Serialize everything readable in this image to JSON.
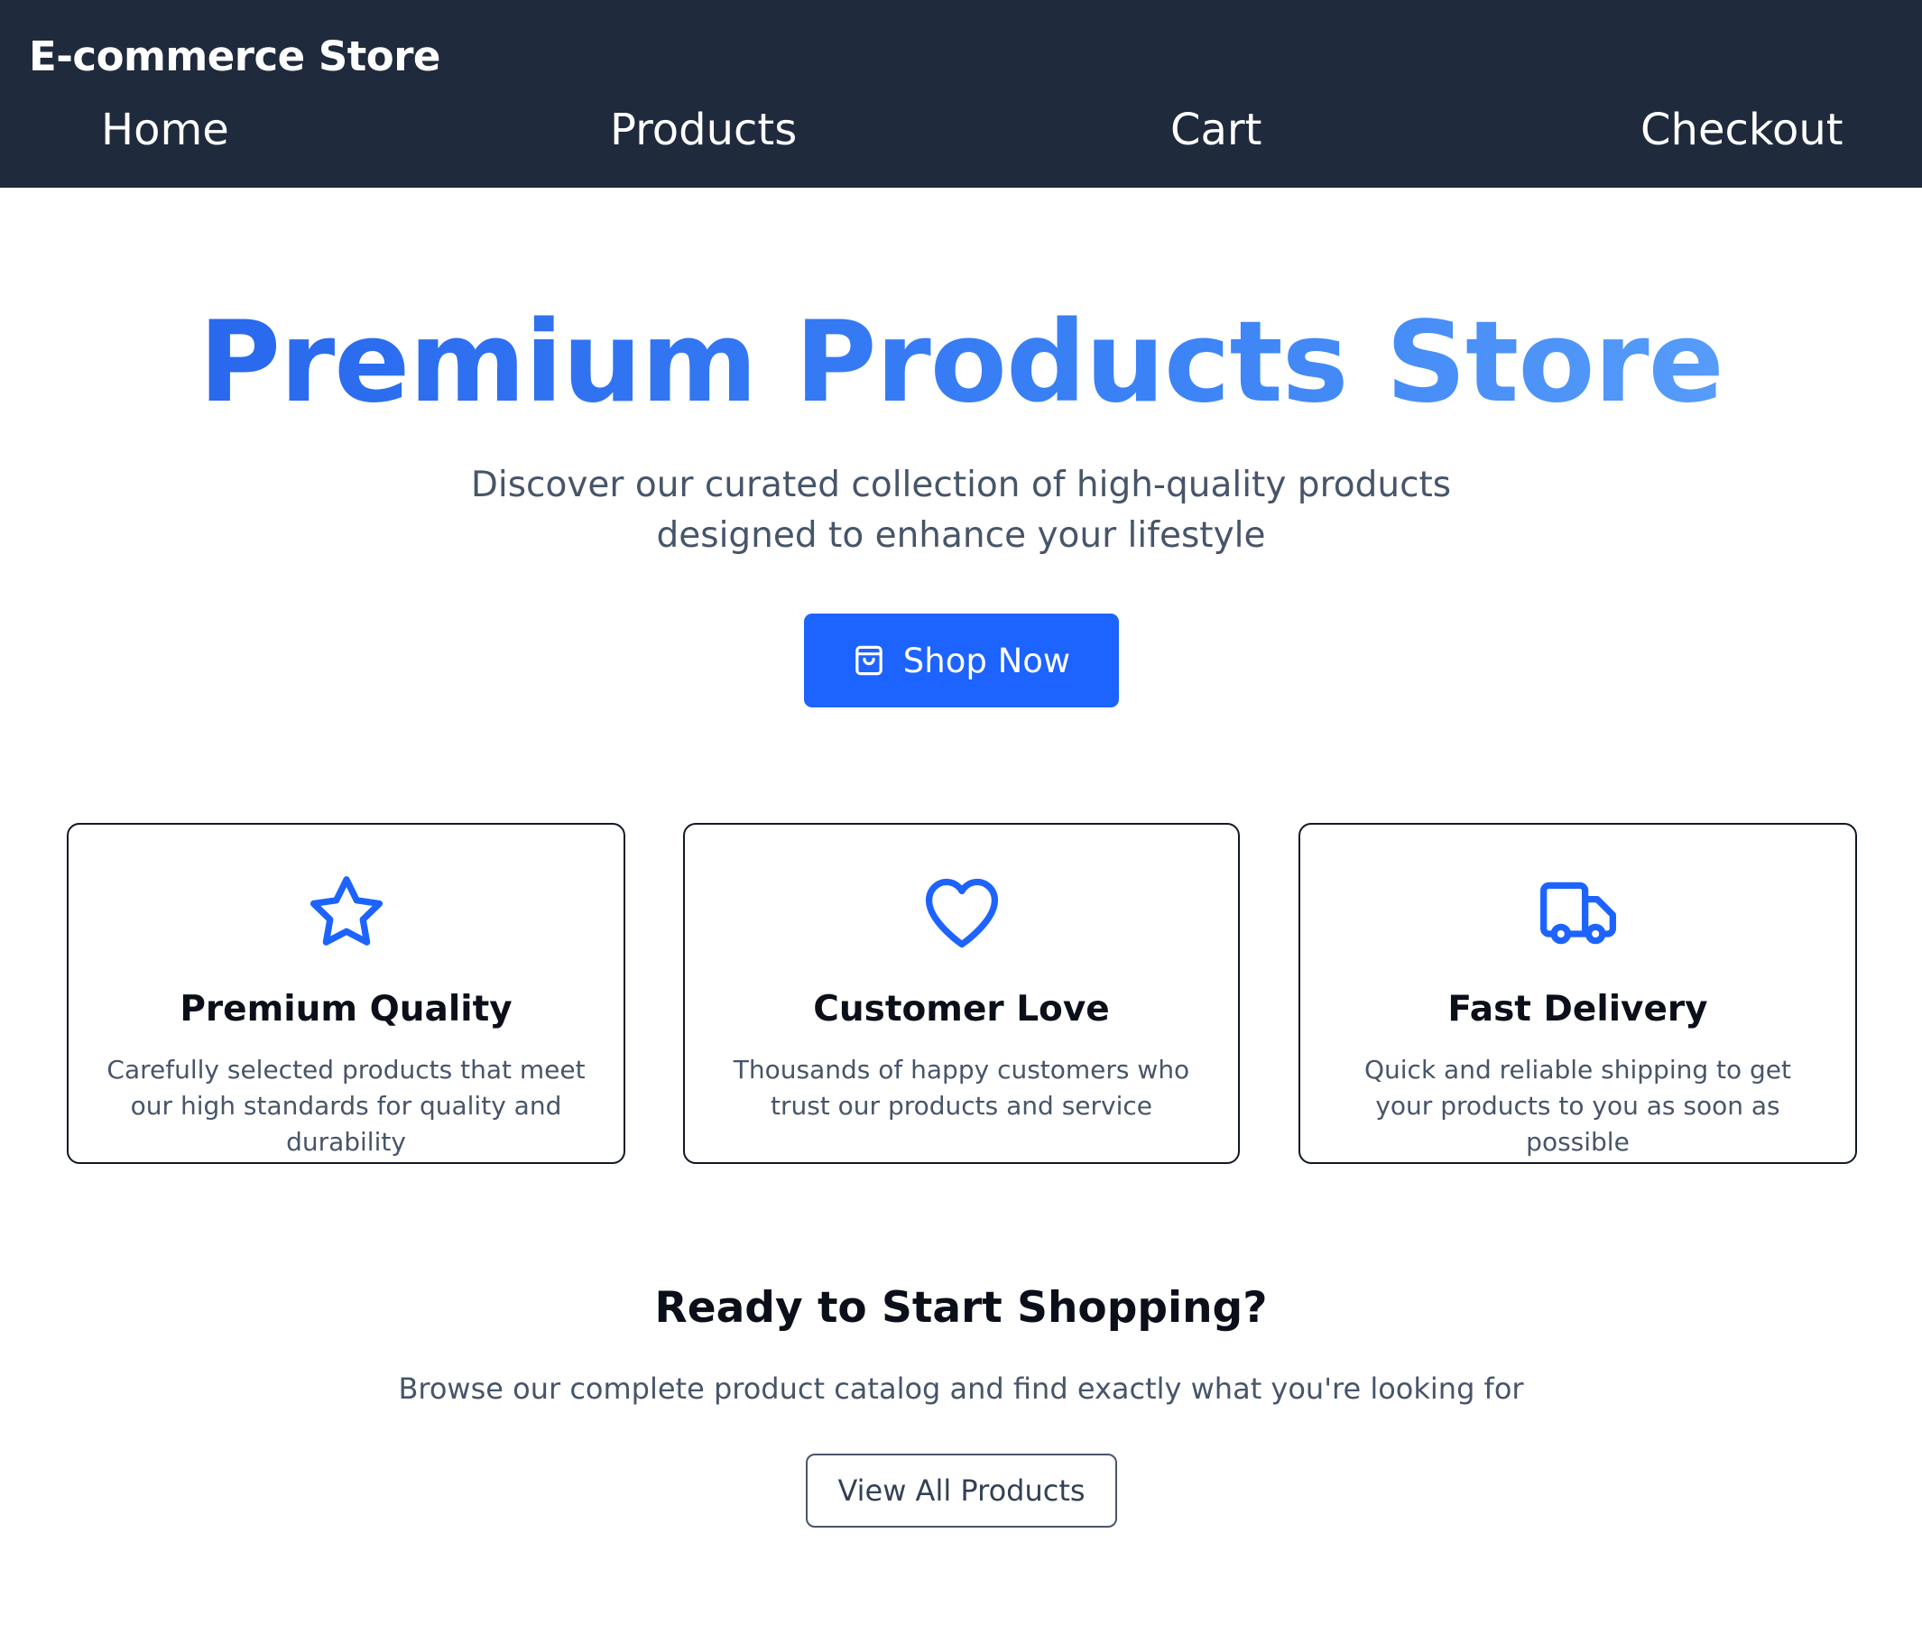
{
  "header": {
    "brand": "E-commerce Store",
    "nav": [
      "Home",
      "Products",
      "Cart",
      "Checkout"
    ]
  },
  "hero": {
    "title": "Premium Products Store",
    "subtitle": "Discover our curated collection of high-quality products designed to enhance your lifestyle",
    "button_label": "Shop Now",
    "button_icon": "shopping-bag-icon"
  },
  "features": [
    {
      "icon": "star-icon",
      "title": "Premium Quality",
      "description": "Carefully selected products that meet our high standards for quality and durability"
    },
    {
      "icon": "heart-icon",
      "title": "Customer Love",
      "description": "Thousands of happy customers who trust our products and service"
    },
    {
      "icon": "truck-icon",
      "title": "Fast Delivery",
      "description": "Quick and reliable shipping to get your products to you as soon as possible"
    }
  ],
  "cta": {
    "title": "Ready to Start Shopping?",
    "subtitle": "Browse our complete product catalog and find exactly what you're looking for",
    "button_label": "View All Products"
  },
  "colors": {
    "header_bg": "#1f2a3c",
    "accent": "#1d63ff",
    "muted_text": "#475569"
  }
}
